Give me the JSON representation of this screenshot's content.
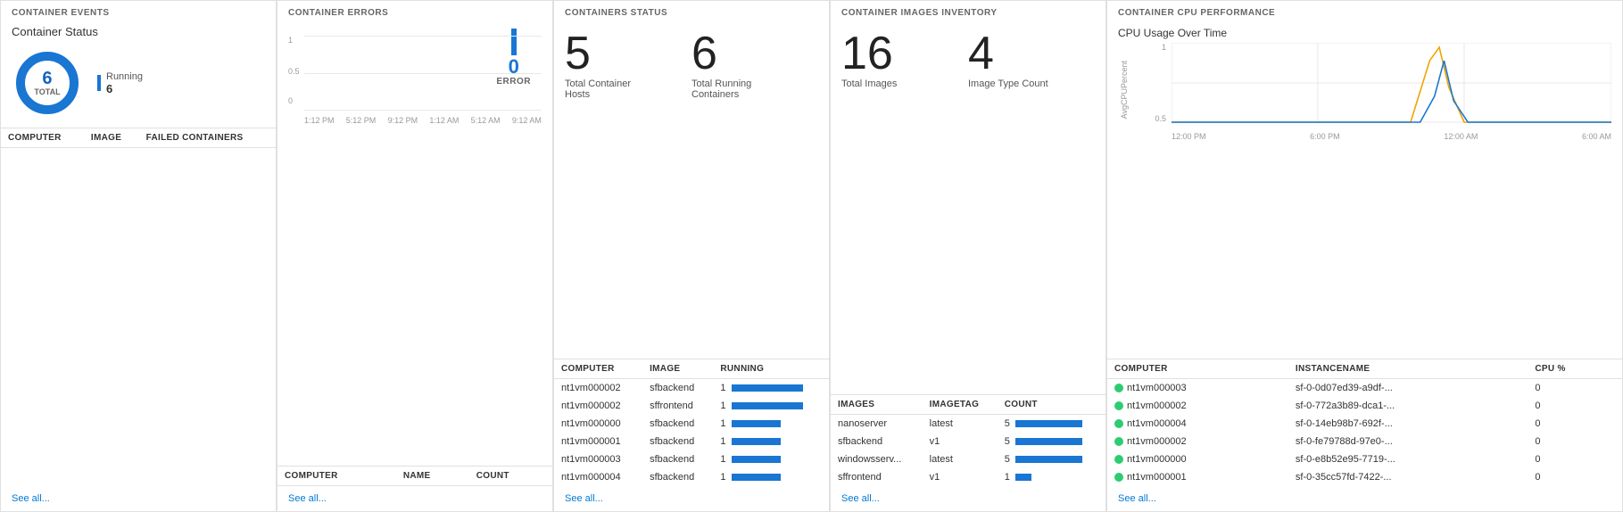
{
  "panels": {
    "events": {
      "header": "CONTAINER EVENTS",
      "title": "Container Status",
      "donut": {
        "total": "6",
        "total_label": "TOTAL",
        "running_label": "Running",
        "running_value": "6"
      },
      "see_all": "See all..."
    },
    "errors": {
      "header": "CONTAINER ERRORS",
      "error_count": "0",
      "error_label": "ERROR",
      "y_labels": [
        "1",
        "0.5",
        "0"
      ],
      "x_labels": [
        "1:12 PM",
        "5:12 PM",
        "9:12 PM",
        "1:12 AM",
        "5:12 AM",
        "9:12 AM"
      ],
      "columns": [
        "COMPUTER",
        "NAME",
        "COUNT"
      ],
      "rows": [],
      "see_all": "See all..."
    },
    "containers_status": {
      "header": "CONTAINERS STATUS",
      "stat1_num": "5",
      "stat1_label": "Total Container Hosts",
      "stat2_num": "6",
      "stat2_label": "Total Running Containers",
      "columns": [
        "COMPUTER",
        "IMAGE",
        "RUNNING"
      ],
      "rows": [
        {
          "computer": "nt1vm000002",
          "image": "sfbackend",
          "running": "1",
          "bar": "long"
        },
        {
          "computer": "nt1vm000002",
          "image": "sffrontend",
          "running": "1",
          "bar": "long"
        },
        {
          "computer": "nt1vm000000",
          "image": "sfbackend",
          "running": "1",
          "bar": "med"
        },
        {
          "computer": "nt1vm000001",
          "image": "sfbackend",
          "running": "1",
          "bar": "med"
        },
        {
          "computer": "nt1vm000003",
          "image": "sfbackend",
          "running": "1",
          "bar": "med"
        },
        {
          "computer": "nt1vm000004",
          "image": "sfbackend",
          "running": "1",
          "bar": "med"
        }
      ],
      "see_all": "See all..."
    },
    "images": {
      "header": "CONTAINER IMAGES INVENTORY",
      "stat1_num": "16",
      "stat1_label": "Total Images",
      "stat2_num": "4",
      "stat2_label": "Image Type Count",
      "columns": [
        "IMAGES",
        "IMAGETAG",
        "COUNT"
      ],
      "rows": [
        {
          "image": "nanoserver",
          "tag": "latest",
          "count": "5",
          "bar": "full"
        },
        {
          "image": "sfbackend",
          "tag": "v1",
          "count": "5",
          "bar": "full"
        },
        {
          "image": "windowsserv...",
          "tag": "latest",
          "count": "5",
          "bar": "full"
        },
        {
          "image": "sffrontend",
          "tag": "v1",
          "count": "1",
          "bar": "short"
        }
      ],
      "see_all": "See all..."
    },
    "cpu": {
      "header": "CONTAINER CPU PERFORMANCE",
      "chart_title": "CPU Usage Over Time",
      "y_labels": [
        "1",
        "0.5"
      ],
      "x_labels": [
        "12:00 PM",
        "6:00 PM",
        "12:00 AM",
        "6:00 AM"
      ],
      "y_axis_label": "AvgCPUPercent",
      "columns": [
        "COMPUTER",
        "INSTANCENAME",
        "CPU %"
      ],
      "rows": [
        {
          "computer": "nt1vm000003",
          "instance": "sf-0-0d07ed39-a9df-...",
          "cpu": "0"
        },
        {
          "computer": "nt1vm000002",
          "instance": "sf-0-772a3b89-dca1-...",
          "cpu": "0"
        },
        {
          "computer": "nt1vm000004",
          "instance": "sf-0-14eb98b7-692f-...",
          "cpu": "0"
        },
        {
          "computer": "nt1vm000002",
          "instance": "sf-0-fe79788d-97e0-...",
          "cpu": "0"
        },
        {
          "computer": "nt1vm000000",
          "instance": "sf-0-e8b52e95-7719-...",
          "cpu": "0"
        },
        {
          "computer": "nt1vm000001",
          "instance": "sf-0-35cc57fd-7422-...",
          "cpu": "0"
        }
      ],
      "see_all": "See all..."
    }
  }
}
